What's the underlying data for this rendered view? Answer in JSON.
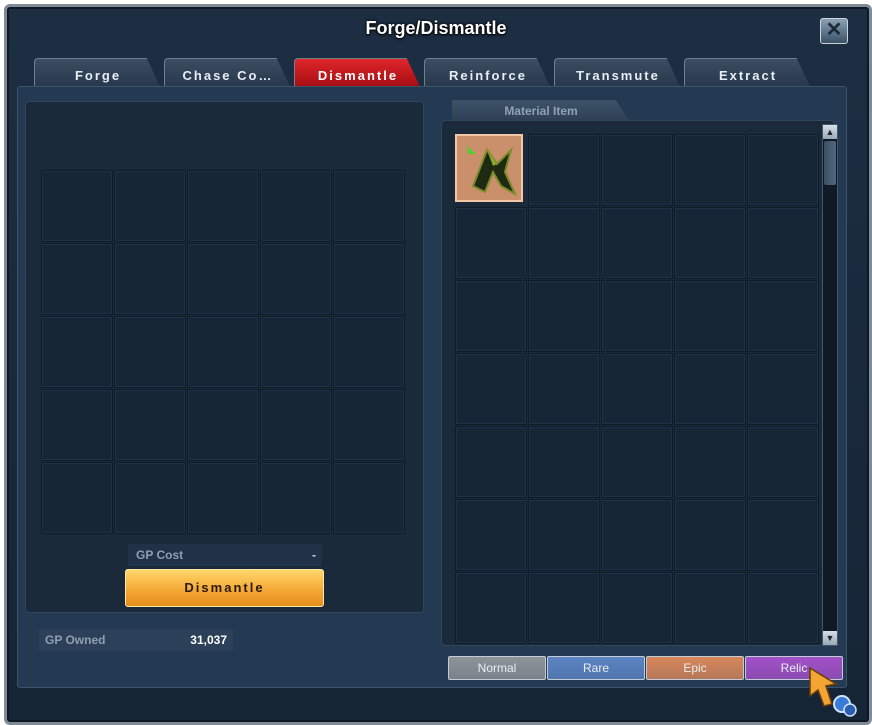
{
  "window": {
    "title": "Forge/Dismantle",
    "close_glyph": "✕"
  },
  "tabs": [
    {
      "label": "Forge",
      "active": false
    },
    {
      "label": "Chase Co…",
      "active": false
    },
    {
      "label": "Dismantle",
      "active": true
    },
    {
      "label": "Reinforce",
      "active": false
    },
    {
      "label": "Transmute",
      "active": false
    },
    {
      "label": "Extract",
      "active": false
    }
  ],
  "dismantle_panel": {
    "grid_rows": 5,
    "grid_cols": 5,
    "gp_cost_label": "GP Cost",
    "gp_cost_value": "-",
    "button_label": "Dismantle"
  },
  "gp_owned": {
    "label": "GP Owned",
    "value": "31,037"
  },
  "material_panel": {
    "tab_label": "Material Item",
    "grid_rows": 7,
    "grid_cols": 5,
    "items": [
      {
        "slot": 0,
        "icon": "green-blade-fragment-icon",
        "rarity": "epic"
      }
    ]
  },
  "scrollbar": {
    "up_glyph": "▲",
    "down_glyph": "▼"
  },
  "filters": [
    {
      "label": "Normal",
      "color": "#8e9499"
    },
    {
      "label": "Rare",
      "color": "#5c84c4"
    },
    {
      "label": "Epic",
      "color": "#d8875a"
    },
    {
      "label": "Relic",
      "color": "#a350c8"
    }
  ],
  "colors": {
    "active_tab": "#c8161c",
    "action_button": "#f3a532"
  }
}
